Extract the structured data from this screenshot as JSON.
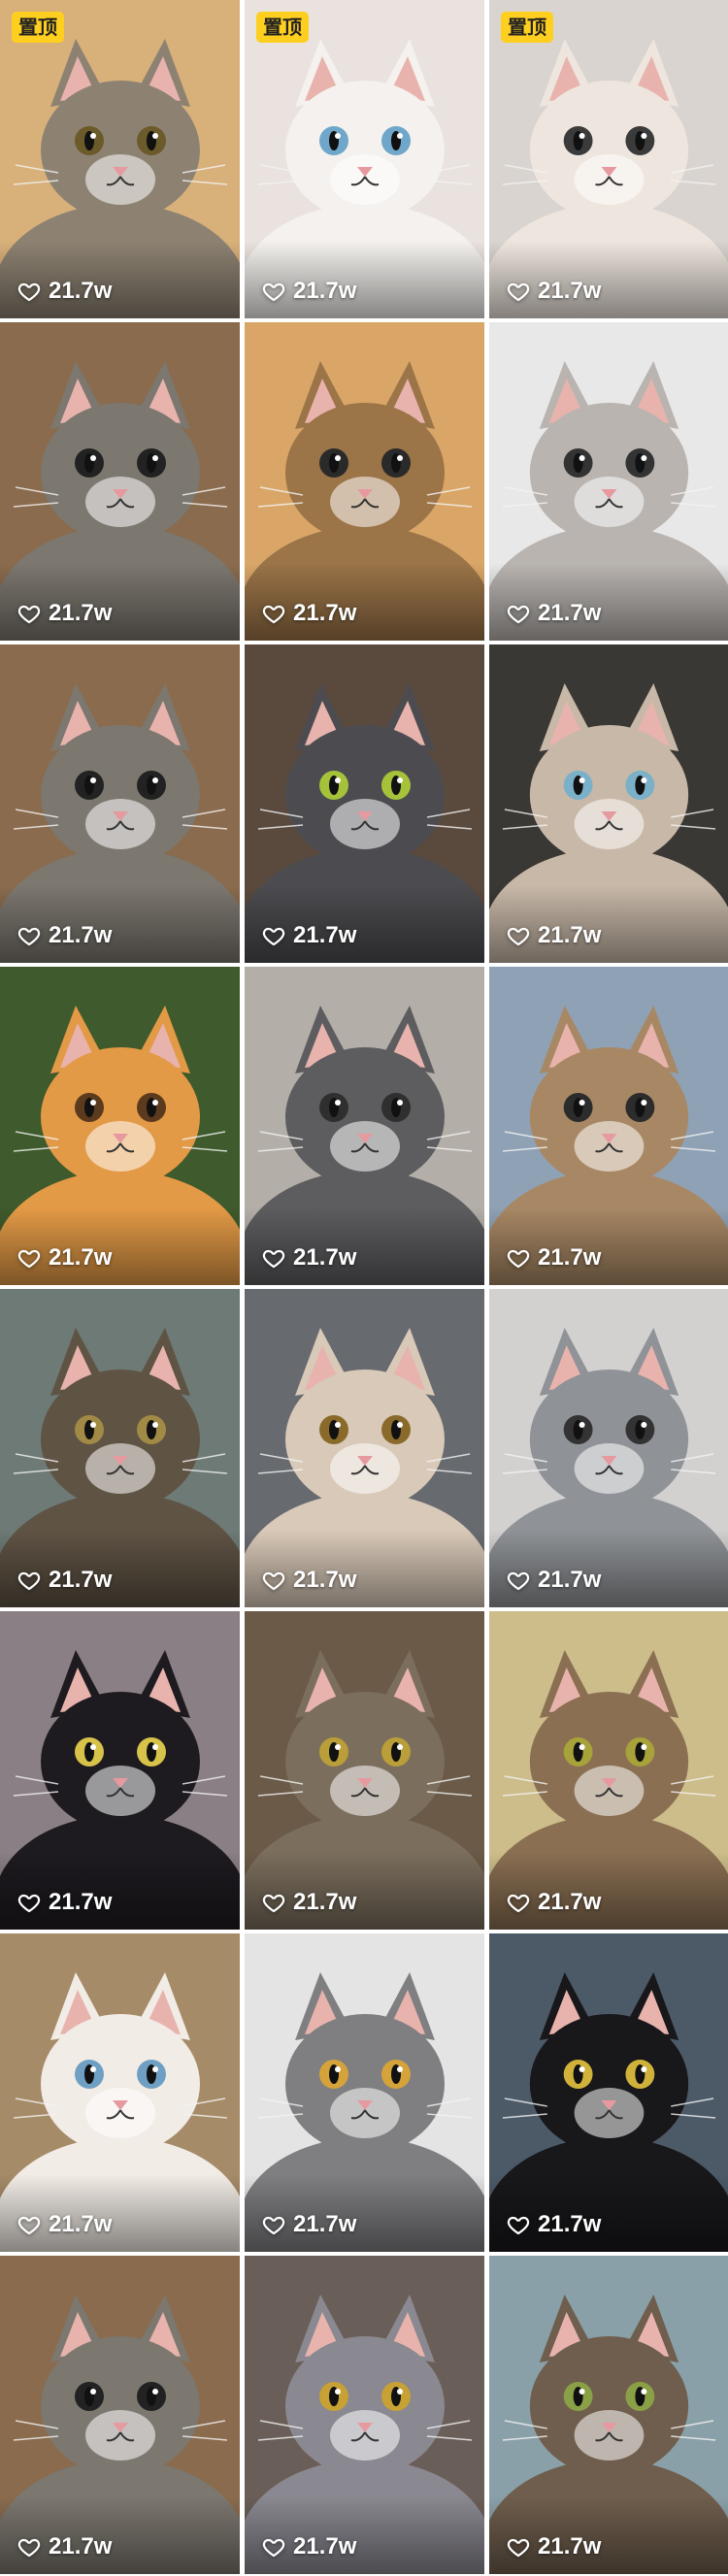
{
  "feed": {
    "items": [
      {
        "likes": "21.7w",
        "pinned": true,
        "pin_label": "置顶",
        "bg": "#d8b07a",
        "fur": "#8d8272",
        "eye": "#6b5a2a"
      },
      {
        "likes": "21.7w",
        "pinned": true,
        "pin_label": "置顶",
        "bg": "#e9e2de",
        "fur": "#f4f1ee",
        "eye": "#6fa6c9"
      },
      {
        "likes": "21.7w",
        "pinned": true,
        "pin_label": "置顶",
        "bg": "#d9d4cf",
        "fur": "#eee6de",
        "eye": "#3b3b3b"
      },
      {
        "likes": "21.7w",
        "pinned": false,
        "bg": "#8a6b4d",
        "fur": "#7c776f",
        "eye": "#222222"
      },
      {
        "likes": "21.7w",
        "pinned": false,
        "bg": "#d9a667",
        "fur": "#9b7448",
        "eye": "#2a2a2a"
      },
      {
        "likes": "21.7w",
        "pinned": false,
        "bg": "#e8e8e8",
        "fur": "#b9b4b0",
        "eye": "#333333"
      },
      {
        "likes": "21.7w",
        "pinned": false,
        "bg": "#8a6b4d",
        "fur": "#7c776f",
        "eye": "#222222"
      },
      {
        "likes": "21.7w",
        "pinned": false,
        "bg": "#5a4a3e",
        "fur": "#4c4c50",
        "eye": "#a6c23a"
      },
      {
        "likes": "21.7w",
        "pinned": false,
        "bg": "#3a3834",
        "fur": "#c8b8a8",
        "eye": "#7ab0c8"
      },
      {
        "likes": "21.7w",
        "pinned": false,
        "bg": "#3f5a2c",
        "fur": "#e39a46",
        "eye": "#5b3a1e"
      },
      {
        "likes": "21.7w",
        "pinned": false,
        "bg": "#b4aea8",
        "fur": "#5d5d60",
        "eye": "#2f2f2f"
      },
      {
        "likes": "21.7w",
        "pinned": false,
        "bg": "#8fa1b5",
        "fur": "#a88864",
        "eye": "#2c2c2c"
      },
      {
        "likes": "21.7w",
        "pinned": false,
        "bg": "#6d7a76",
        "fur": "#5f5344",
        "eye": "#a18a45"
      },
      {
        "likes": "21.7w",
        "pinned": false,
        "bg": "#676a6f",
        "fur": "#d9c9b8",
        "eye": "#8a6a2a"
      },
      {
        "likes": "21.7w",
        "pinned": false,
        "bg": "#d3d0d0",
        "fur": "#8f9296",
        "eye": "#333333"
      },
      {
        "likes": "21.7w",
        "pinned": false,
        "bg": "#8a7f84",
        "fur": "#1e1b20",
        "eye": "#d7c34a"
      },
      {
        "likes": "21.7w",
        "pinned": false,
        "bg": "#6a5a47",
        "fur": "#7b6e5d",
        "eye": "#b99e3a"
      },
      {
        "likes": "21.7w",
        "pinned": false,
        "bg": "#cdbd8a",
        "fur": "#8a6f52",
        "eye": "#a7a23a"
      },
      {
        "likes": "21.7w",
        "pinned": false,
        "bg": "#a68b68",
        "fur": "#f2ece6",
        "eye": "#6fa0c4"
      },
      {
        "likes": "21.7w",
        "pinned": false,
        "bg": "#e4e4e4",
        "fur": "#7f7f82",
        "eye": "#d6a23a"
      },
      {
        "likes": "21.7w",
        "pinned": false,
        "bg": "#4c5a68",
        "fur": "#18171a",
        "eye": "#d0b23a"
      },
      {
        "likes": "21.7w",
        "pinned": false,
        "bg": "#8a6b4d",
        "fur": "#7c776f",
        "eye": "#222222"
      },
      {
        "likes": "21.7w",
        "pinned": false,
        "bg": "#6a5f58",
        "fur": "#8a8890",
        "eye": "#c7a133"
      },
      {
        "likes": "21.7w",
        "pinned": false,
        "bg": "#8aa0a8",
        "fur": "#6f5e4d",
        "eye": "#8aa046"
      }
    ]
  }
}
